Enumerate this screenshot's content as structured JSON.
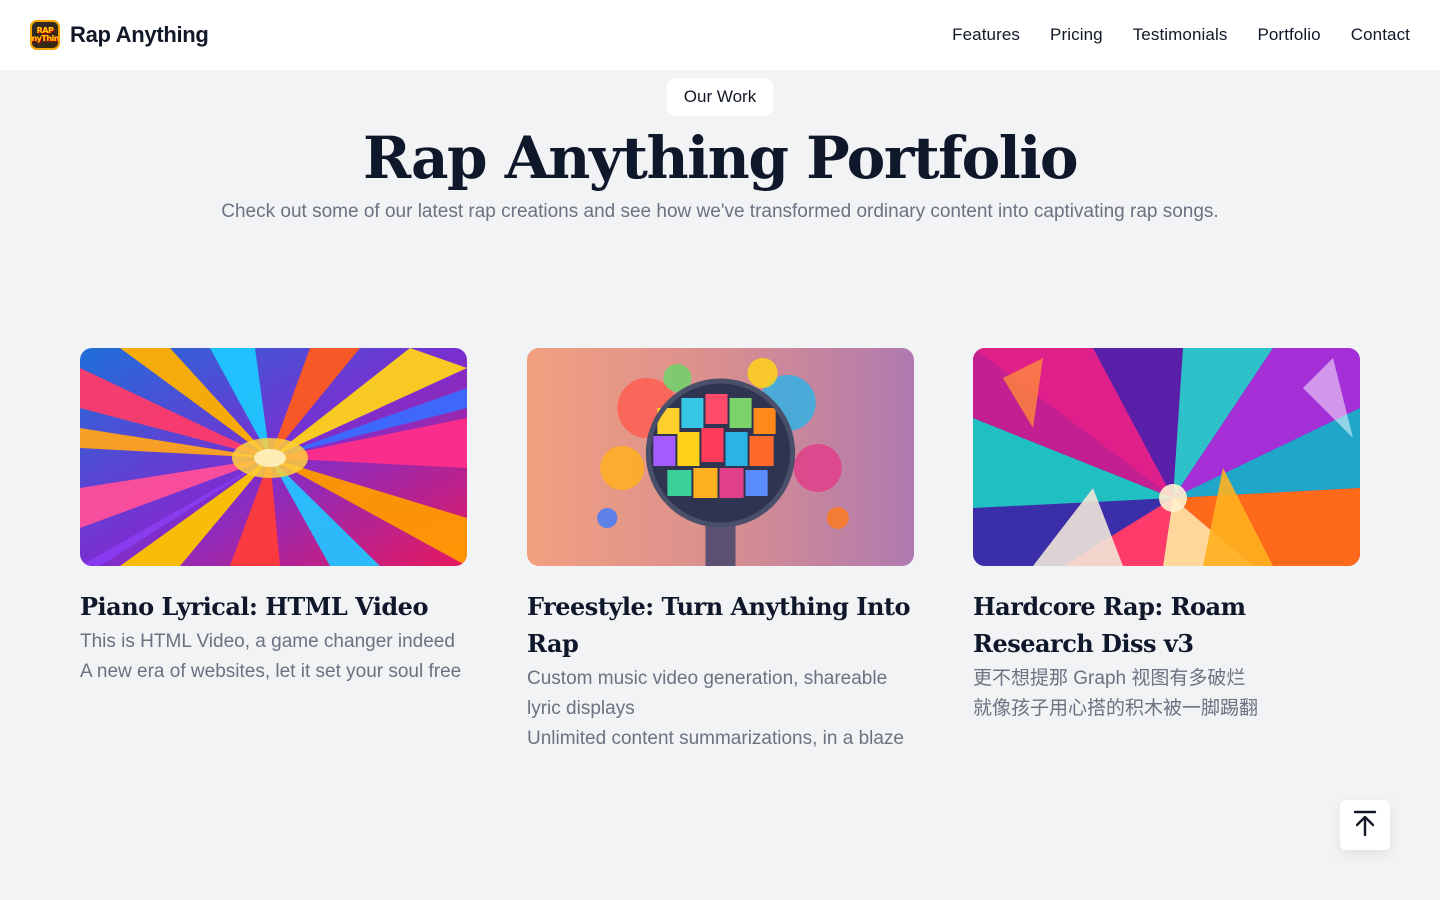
{
  "header": {
    "logo_text": "RAP Anything",
    "brand_name": "Rap Anything",
    "nav": [
      "Features",
      "Pricing",
      "Testimonials",
      "Portfolio",
      "Contact"
    ]
  },
  "hero": {
    "eyebrow": "Our Work",
    "title": "Rap Anything Portfolio",
    "subtitle": "Check out some of our latest rap creations and see how we've transformed ordinary content into captivating rap songs."
  },
  "portfolio": [
    {
      "title": "Piano Lyrical: HTML Video",
      "lines": [
        "This is HTML Video, a game changer indeed",
        "A new era of websites, let it set your soul free"
      ]
    },
    {
      "title": "Freestyle: Turn Anything Into Rap",
      "lines": [
        "Custom music video generation, shareable lyric displays",
        "Unlimited content summarizations, in a blaze"
      ]
    },
    {
      "title": "Hardcore Rap: Roam Research Diss v3",
      "lines": [
        "更不想提那 Graph 视图有多破烂",
        "就像孩子用心搭的积木被一脚踢翻"
      ]
    }
  ],
  "icons": {
    "back_to_top": "arrow-up-to-line-icon"
  },
  "colors": {
    "page_bg": "#f2f3f5",
    "heading": "#0f172a",
    "muted": "#6b7280"
  }
}
